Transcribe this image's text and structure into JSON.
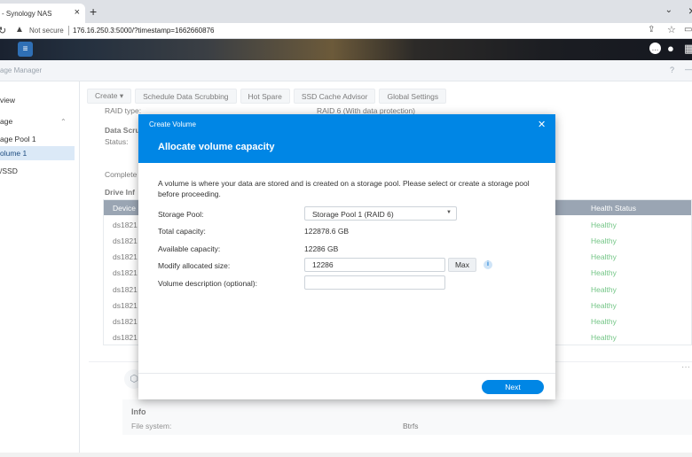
{
  "browser": {
    "tab_title": "- Synology NAS",
    "not_secure": "Not secure",
    "url": "176.16.250.3:5000/?timestamp=1662660876"
  },
  "app": {
    "title": "age Manager"
  },
  "sidebar": {
    "items": [
      {
        "label": "view"
      },
      {
        "label": "age"
      },
      {
        "label": "age Pool 1"
      },
      {
        "label": "olume 1"
      },
      {
        "label": "/SSD"
      }
    ]
  },
  "toolbar": {
    "create": "Create ▾",
    "scrub": "Schedule Data Scrubbing",
    "hotspare": "Hot Spare",
    "ssdcache": "SSD Cache Advisor",
    "globalsettings": "Global Settings"
  },
  "background": {
    "raid_type_label": "RAID type:",
    "raid_type_value": "RAID 6 (With data protection)",
    "data_scrub": "Data Scru",
    "status_label": "Status:",
    "completed": "Complete",
    "drive_info": "Drive Inf",
    "col_device": "Device",
    "col_health": "Health Status",
    "rows": [
      {
        "device": "ds1821",
        "health": "Healthy"
      },
      {
        "device": "ds1821",
        "health": "Healthy"
      },
      {
        "device": "ds1821",
        "health": "Healthy"
      },
      {
        "device": "ds1821",
        "health": "Healthy"
      },
      {
        "device": "ds1821",
        "health": "Healthy"
      },
      {
        "device": "ds1821",
        "health": "Healthy"
      },
      {
        "device": "ds1821",
        "health": "Healthy"
      },
      {
        "device": "ds1821",
        "health": "Healthy"
      }
    ],
    "info_title": "Info",
    "fs_label": "File system:",
    "fs_value": "Btrfs"
  },
  "modal": {
    "small_title": "Create Volume",
    "title": "Allocate volume capacity",
    "description": "A volume is where your data are stored and is created on a storage pool. Please select or create a storage pool before proceeding.",
    "storage_pool_label": "Storage Pool:",
    "storage_pool_value": "Storage Pool 1 (RAID 6)",
    "total_capacity_label": "Total capacity:",
    "total_capacity_value": "122878.6 GB",
    "available_capacity_label": "Available capacity:",
    "available_capacity_value": "12286 GB",
    "modify_size_label": "Modify allocated size:",
    "modify_size_value": "12286",
    "max_label": "Max",
    "description_label": "Volume description (optional):",
    "description_value": "",
    "next_label": "Next"
  },
  "colors": {
    "accent": "#0086e5",
    "healthy": "#28a745",
    "table_header": "#64768a"
  }
}
